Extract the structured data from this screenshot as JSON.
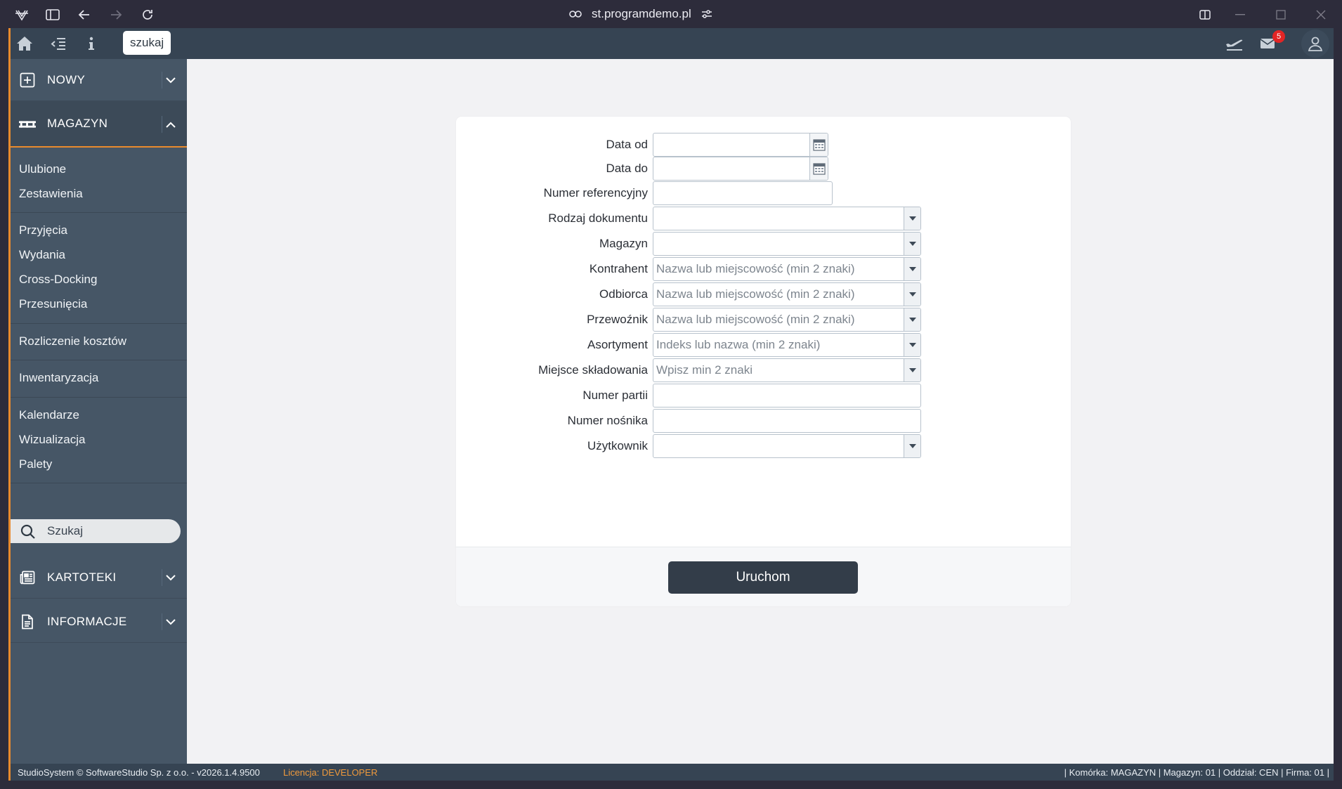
{
  "browser": {
    "url": "st.programdemo.pl"
  },
  "topbar": {
    "search_button": "szukaj",
    "mail_count": "5"
  },
  "sidebar": {
    "sections": {
      "nowy": "NOWY",
      "magazyn": "MAGAZYN",
      "kartoteki": "KARTOTEKI",
      "informacje": "INFORMACJE"
    },
    "items": [
      "Ulubione",
      "Zestawienia",
      "Przyjęcia",
      "Wydania",
      "Cross-Docking",
      "Przesunięcia",
      "Rozliczenie kosztów",
      "Inwentaryzacja",
      "Kalendarze",
      "Wizualizacja",
      "Palety"
    ],
    "search_label": "Szukaj"
  },
  "form": {
    "fields": [
      {
        "label": "Data od",
        "value": "",
        "kind": "date"
      },
      {
        "label": "Data do",
        "value": "",
        "kind": "date"
      },
      {
        "label": "Numer referencyjny",
        "value": "",
        "kind": "text"
      },
      {
        "label": "Rodzaj dokumentu",
        "value": "",
        "kind": "select"
      },
      {
        "label": "Magazyn",
        "value": "",
        "kind": "select"
      },
      {
        "label": "Kontrahent",
        "placeholder": "Nazwa lub miejscowość (min 2 znaki)",
        "kind": "select"
      },
      {
        "label": "Odbiorca",
        "placeholder": "Nazwa lub miejscowość (min 2 znaki)",
        "kind": "select"
      },
      {
        "label": "Przewoźnik",
        "placeholder": "Nazwa lub miejscowość (min 2 znaki)",
        "kind": "select"
      },
      {
        "label": "Asortyment",
        "placeholder": "Indeks lub nazwa (min 2 znaki)",
        "kind": "select"
      },
      {
        "label": "Miejsce składowania",
        "placeholder": "Wpisz min 2 znaki",
        "kind": "select"
      },
      {
        "label": "Numer partii",
        "value": "",
        "kind": "text"
      },
      {
        "label": "Numer nośnika",
        "value": "",
        "kind": "text"
      },
      {
        "label": "Użytkownik",
        "value": "",
        "kind": "select"
      }
    ],
    "run_button": "Uruchom"
  },
  "status": {
    "left": "StudioSystem © SoftwareStudio Sp. z o.o. - v2026.1.4.9500",
    "license_label": "Licencja:",
    "license_value": "DEVELOPER",
    "right": "| Komórka: MAGAZYN | Magazyn: 01 | Oddział: CEN | Firma: 01 |"
  },
  "colors": {
    "accent": "#e98a2d",
    "sidebar": "#465666",
    "topbar": "#364453",
    "badge": "#e32525"
  }
}
